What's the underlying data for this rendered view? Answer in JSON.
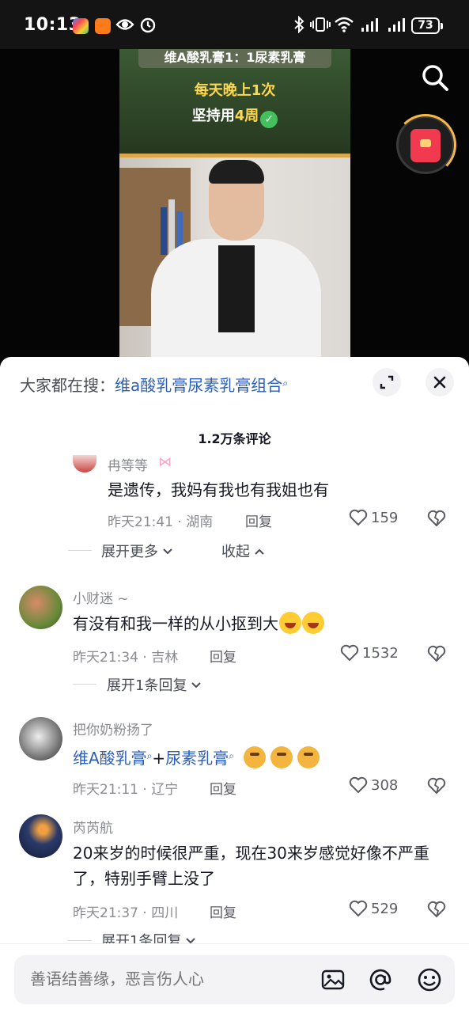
{
  "status_bar": {
    "time": "10:13",
    "battery": "73"
  },
  "video": {
    "overlay_title": "维A酸乳膏1：1尿素乳膏",
    "line1": "每天晚上1次",
    "line2_prefix": "坚持用",
    "line2_highlight": "4周"
  },
  "sheet": {
    "search_label": "大家都在搜：",
    "search_keyword": "维a酸乳膏尿素乳膏组合",
    "comment_count": "1.2万条评论"
  },
  "comments": [
    {
      "name": "冉等等",
      "text": "是遗传，我妈有我也有我姐也有",
      "meta": "昨天21:41 · 湖南",
      "reply": "回复",
      "likes": "159"
    },
    {
      "name": "小财迷 ~",
      "text": "有没有和我一样的从小抠到大",
      "meta": "昨天21:34 · 吉林",
      "reply": "回复",
      "likes": "1532"
    },
    {
      "name": "把你奶粉扬了",
      "text_kw1": "维A酸乳膏",
      "text_plus": "+",
      "text_kw2": "尿素乳膏",
      "meta": "昨天21:11 · 辽宁",
      "reply": "回复",
      "likes": "308"
    },
    {
      "name": "芮芮航",
      "text": "20来岁的时候很严重，现在30来岁感觉好像不严重了，特别手臂上没了",
      "meta": "昨天21:37 · 四川",
      "reply": "回复",
      "likes": "529"
    }
  ],
  "expand": {
    "more": "展开更多",
    "collapse": "收起",
    "one_reply": "展开1条回复"
  },
  "input": {
    "placeholder": "善语结善缘，恶言伤人心"
  },
  "colors": {
    "link": "#2b5eb8",
    "accent_red": "#f13a4f"
  }
}
